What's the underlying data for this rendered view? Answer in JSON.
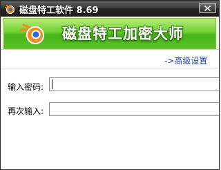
{
  "window": {
    "title": "磁盘特工软件 8.69",
    "banner_title": "磁盘特工加密大师"
  },
  "content": {
    "advanced_link": "->高级设置",
    "password_label": "输入密码:",
    "password_value": "",
    "confirm_label": "再次输入:",
    "confirm_value": ""
  },
  "colors": {
    "banner_green": "#5cc327",
    "link_blue": "#1f3f9e",
    "titlebar_dark": "#262626"
  },
  "icons": {
    "app": "blender-style-logo-icon",
    "close": "close-icon"
  }
}
